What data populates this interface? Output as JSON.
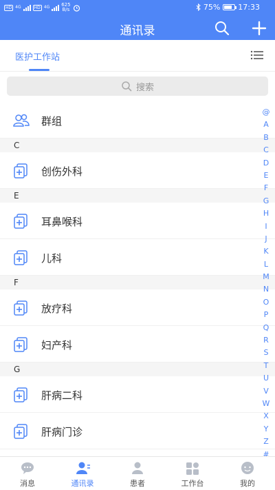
{
  "status_bar": {
    "net_label_1": "HD",
    "net_label_2": "HD",
    "gen_1": "4G",
    "gen_2": "4G",
    "speed_value": "625",
    "speed_unit": "B/s",
    "battery": "75%",
    "battery_level": 0.75,
    "time": "17:33"
  },
  "header": {
    "title": "通讯录",
    "search_icon": "search-icon",
    "add_icon": "plus-icon"
  },
  "station": {
    "tab_label": "医护工作站",
    "menu_icon": "list-menu-icon"
  },
  "search": {
    "placeholder": "搜索"
  },
  "contacts": {
    "group_label": "群组",
    "sections": [
      {
        "letter": "C",
        "items": [
          "创伤外科"
        ]
      },
      {
        "letter": "E",
        "items": [
          "耳鼻喉科",
          "儿科"
        ]
      },
      {
        "letter": "F",
        "items": [
          "放疗科",
          "妇产科"
        ]
      },
      {
        "letter": "G",
        "items": [
          "肝病二科",
          "肝病门诊"
        ]
      }
    ]
  },
  "alphabet_index": [
    "@",
    "A",
    "B",
    "C",
    "D",
    "E",
    "F",
    "G",
    "H",
    "I",
    "J",
    "K",
    "L",
    "M",
    "N",
    "O",
    "P",
    "Q",
    "R",
    "S",
    "T",
    "U",
    "V",
    "W",
    "X",
    "Y",
    "Z",
    "#"
  ],
  "bottom_nav": [
    {
      "label": "消息",
      "icon": "chat-bubble-icon",
      "active": false
    },
    {
      "label": "通讯录",
      "icon": "contacts-icon",
      "active": true
    },
    {
      "label": "患者",
      "icon": "patient-icon",
      "active": false
    },
    {
      "label": "工作台",
      "icon": "workbench-icon",
      "active": false
    },
    {
      "label": "我的",
      "icon": "profile-icon",
      "active": false
    }
  ],
  "colors": {
    "primary": "#4f86f7",
    "section_bg": "#f5f5f5",
    "search_bg": "#ebebeb"
  }
}
